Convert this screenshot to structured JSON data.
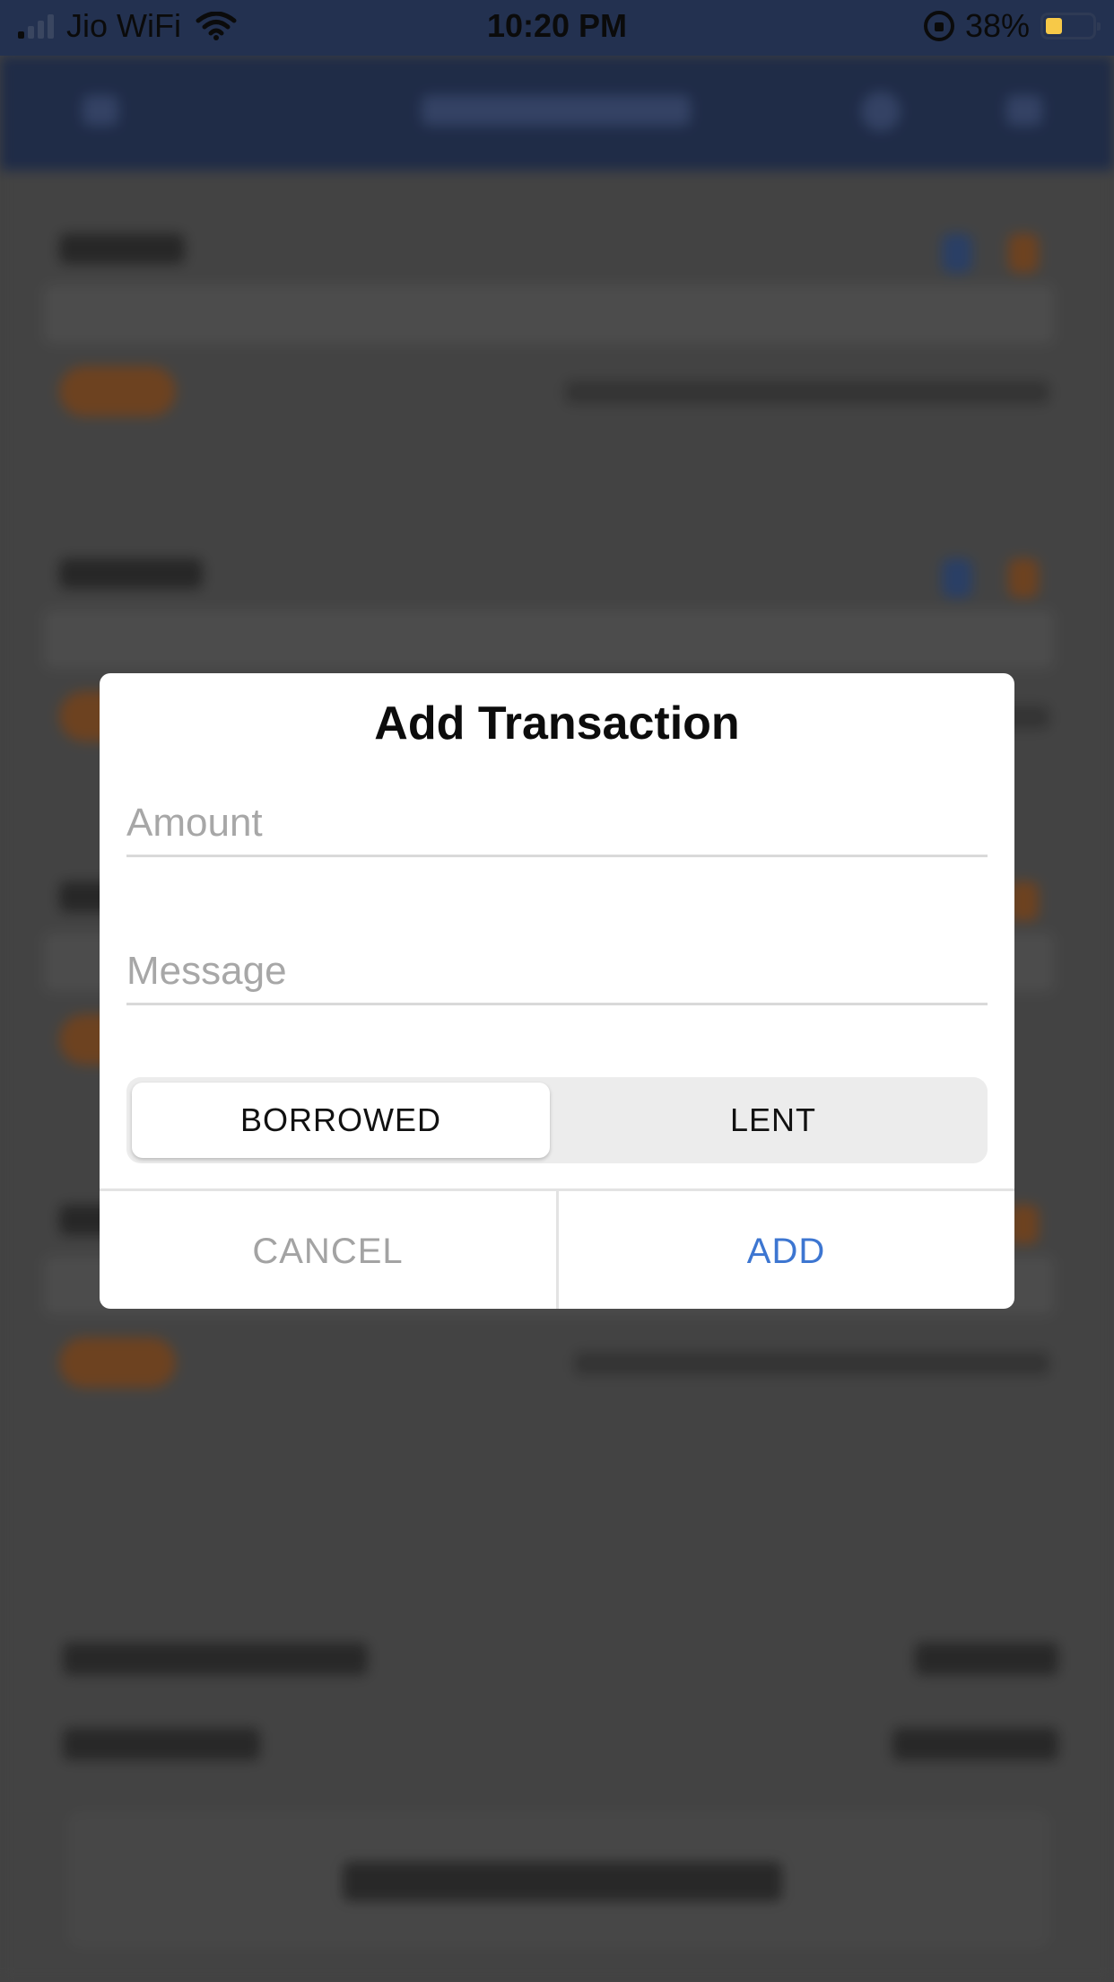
{
  "status_bar": {
    "carrier": "Jio WiFi",
    "time": "10:20 PM",
    "battery_percent": "38%",
    "battery_color": "#f7c948"
  },
  "dialog": {
    "title": "Add Transaction",
    "amount_placeholder": "Amount",
    "message_placeholder": "Message",
    "segment": {
      "options": [
        "BORROWED",
        "LENT"
      ],
      "selected": "BORROWED"
    },
    "cancel_label": "CANCEL",
    "add_label": "ADD",
    "accent_color": "#3d76d1"
  }
}
